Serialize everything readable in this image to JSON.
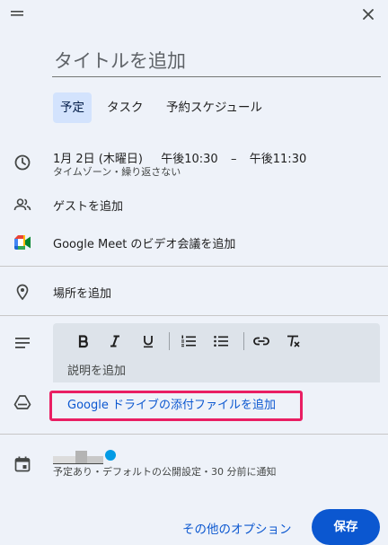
{
  "window": {
    "drag_handle_icon": "drag-handle-icon",
    "close_icon": "close-icon"
  },
  "title": {
    "placeholder": "タイトルを追加"
  },
  "tabs": [
    {
      "label": "予定",
      "active": true
    },
    {
      "label": "タスク",
      "active": false
    },
    {
      "label": "予約スケジュール",
      "active": false
    }
  ],
  "datetime": {
    "date": "1月 2日 (木曜日)",
    "start": "午後10:30",
    "separator": "–",
    "end": "午後11:30",
    "subtitle": "タイムゾーン・繰り返さない"
  },
  "guests": {
    "label": "ゲストを追加"
  },
  "meet": {
    "label": "Google Meet のビデオ会議を追加"
  },
  "location": {
    "label": "場所を追加"
  },
  "description": {
    "placeholder": "説明を追加",
    "toolbar": [
      "bold-icon",
      "italic-icon",
      "underline-icon",
      "numbered-list-icon",
      "bulleted-list-icon",
      "link-icon",
      "clear-formatting-icon"
    ]
  },
  "attachment": {
    "label": "Google ドライブの添付ファイルを追加"
  },
  "calendar": {
    "status": "予定あり・デフォルトの公開設定・30 分前に通知",
    "color": "#039be5"
  },
  "footer": {
    "more_options": "その他のオプション",
    "save": "保存"
  },
  "colors": {
    "background": "#eef2f9",
    "accent": "#0b57d0",
    "active_tab": "#d3e3fd",
    "highlight_border": "#e91e63"
  }
}
